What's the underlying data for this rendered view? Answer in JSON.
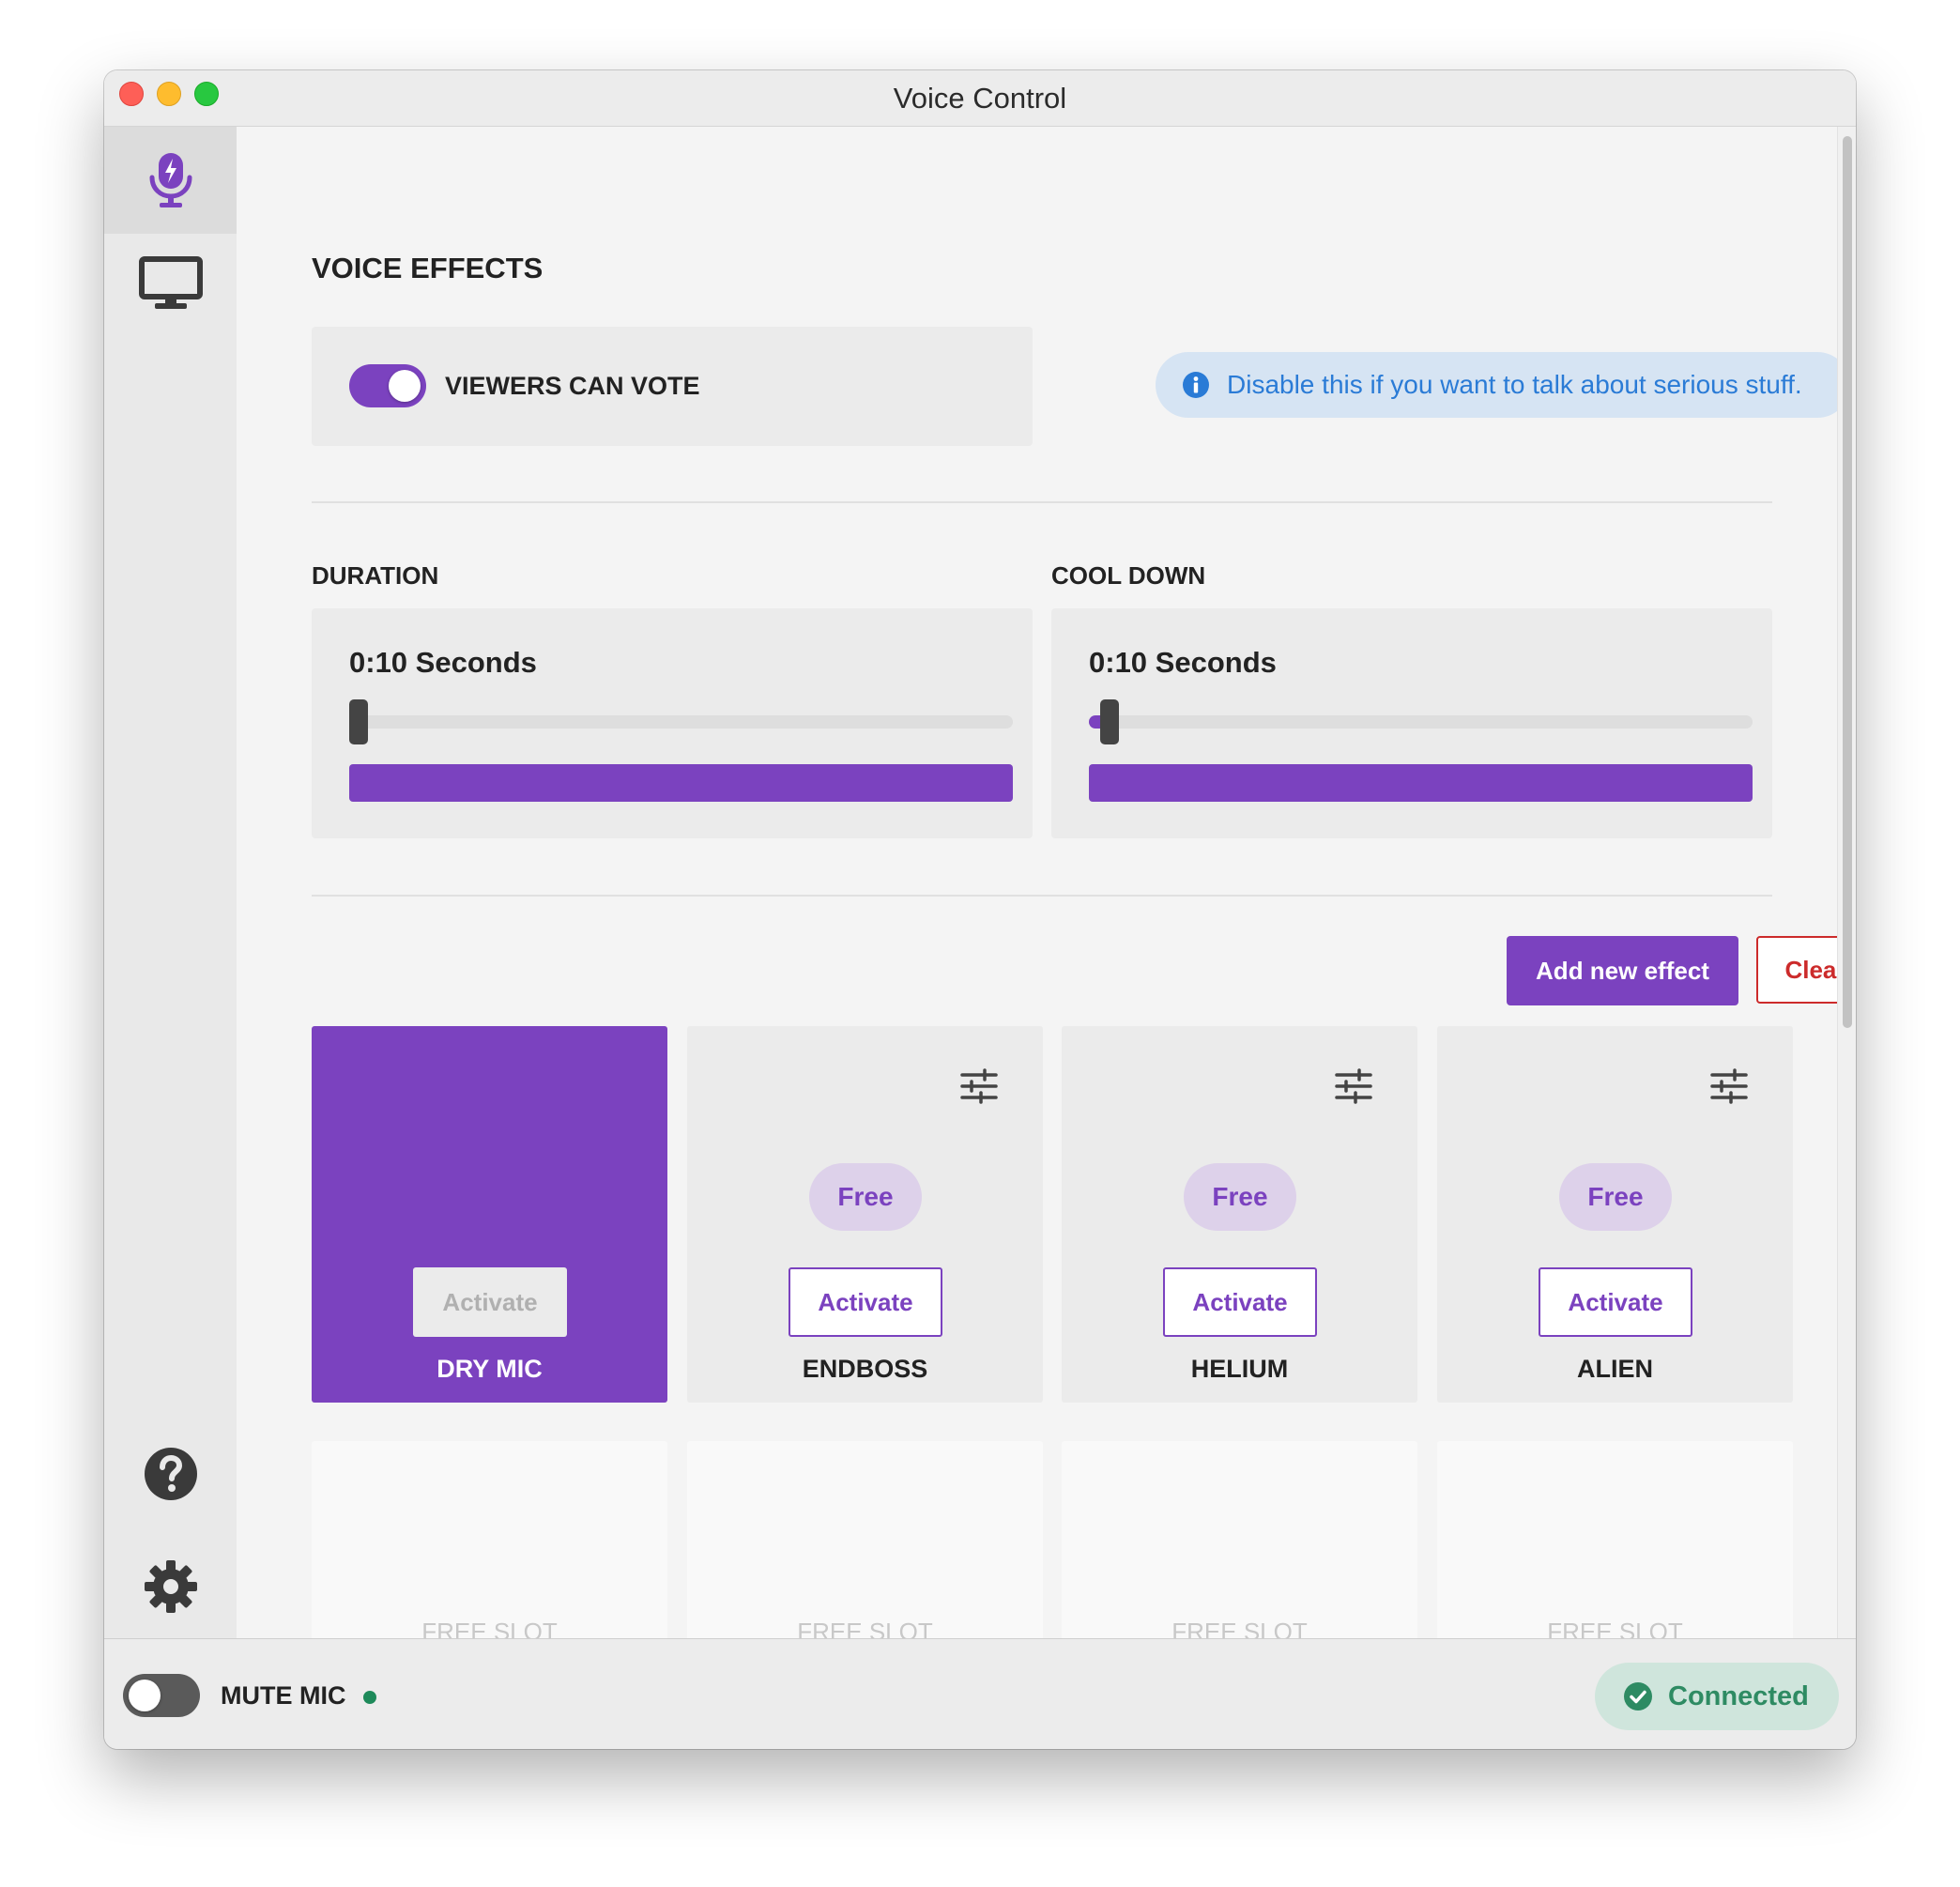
{
  "window": {
    "title": "Voice Control"
  },
  "sidebar": {
    "items": [
      {
        "icon": "mic-lightning-icon",
        "active": true
      },
      {
        "icon": "monitor-icon",
        "active": false
      },
      {
        "icon": "help-icon",
        "active": false
      },
      {
        "icon": "gear-icon",
        "active": false
      }
    ]
  },
  "main": {
    "section_title": "VOICE EFFECTS",
    "viewers_vote": {
      "label": "VIEWERS CAN VOTE",
      "on": true
    },
    "info": {
      "icon": "info-icon",
      "text": "Disable this if you want to talk about serious stuff."
    },
    "duration": {
      "label": "DURATION",
      "value": "0:10 Seconds"
    },
    "cooldown": {
      "label": "COOL DOWN",
      "value": "0:10 Seconds"
    },
    "actions": {
      "add_label": "Add new effect",
      "clear_label": "Clear"
    },
    "effects": [
      {
        "name": "DRY MIC",
        "active": true,
        "activate_label": "Activate",
        "badge": ""
      },
      {
        "name": "ENDBOSS",
        "active": false,
        "activate_label": "Activate",
        "badge": "Free"
      },
      {
        "name": "HELIUM",
        "active": false,
        "activate_label": "Activate",
        "badge": "Free"
      },
      {
        "name": "ALIEN",
        "active": false,
        "activate_label": "Activate",
        "badge": "Free"
      }
    ],
    "free_slots": [
      "FREE SLOT",
      "FREE SLOT",
      "FREE SLOT",
      "FREE SLOT"
    ]
  },
  "footer": {
    "mute_label": "MUTE MIC",
    "mute_on": false,
    "connection_status": "Connected"
  },
  "colors": {
    "accent": "#7b42bf",
    "danger": "#cc2b2b",
    "info_text": "#2a7bd6",
    "success": "#2e8b63",
    "status_dot": "#1e8a5a",
    "slot_text": "#c8c8c8"
  }
}
